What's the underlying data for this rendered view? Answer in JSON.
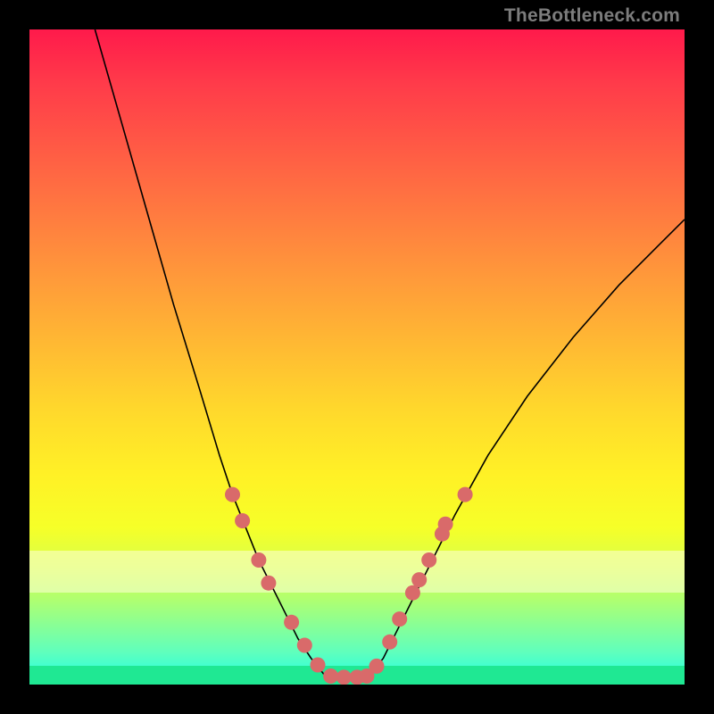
{
  "watermark": "TheBottleneck.com",
  "chart_data": {
    "type": "line",
    "title": "",
    "xlabel": "",
    "ylabel": "",
    "xlim": [
      0,
      100
    ],
    "ylim": [
      0,
      100
    ],
    "grid": false,
    "legend": false,
    "series": [
      {
        "name": "left-curve",
        "x": [
          10,
          14,
          18,
          22,
          26,
          29,
          31,
          33,
          35,
          37,
          39,
          41,
          43,
          45
        ],
        "y": [
          100,
          86,
          72,
          58,
          45,
          35,
          29,
          24,
          19,
          15,
          11,
          7,
          4,
          1.5
        ]
      },
      {
        "name": "right-curve",
        "x": [
          52,
          54,
          56,
          58,
          61,
          65,
          70,
          76,
          83,
          90,
          96,
          100
        ],
        "y": [
          1.5,
          4,
          8,
          12,
          18,
          26,
          35,
          44,
          53,
          61,
          67,
          71
        ]
      },
      {
        "name": "valley-floor",
        "x": [
          45,
          47,
          49,
          50,
          51,
          52
        ],
        "y": [
          1.5,
          1,
          1,
          1,
          1,
          1.5
        ]
      }
    ],
    "markers": {
      "name": "highlighted-points",
      "points": [
        {
          "x": 31,
          "y": 29
        },
        {
          "x": 32.5,
          "y": 25
        },
        {
          "x": 35,
          "y": 19
        },
        {
          "x": 36.5,
          "y": 15.5
        },
        {
          "x": 40,
          "y": 9.5
        },
        {
          "x": 42,
          "y": 6
        },
        {
          "x": 44,
          "y": 3
        },
        {
          "x": 46,
          "y": 1.3
        },
        {
          "x": 48,
          "y": 1.1
        },
        {
          "x": 50,
          "y": 1.1
        },
        {
          "x": 51.5,
          "y": 1.3
        },
        {
          "x": 53,
          "y": 2.8
        },
        {
          "x": 55,
          "y": 6.5
        },
        {
          "x": 56.5,
          "y": 10
        },
        {
          "x": 58.5,
          "y": 14
        },
        {
          "x": 59.5,
          "y": 16
        },
        {
          "x": 61,
          "y": 19
        },
        {
          "x": 63,
          "y": 23
        },
        {
          "x": 63.5,
          "y": 24.5
        },
        {
          "x": 66.5,
          "y": 29
        }
      ]
    }
  }
}
